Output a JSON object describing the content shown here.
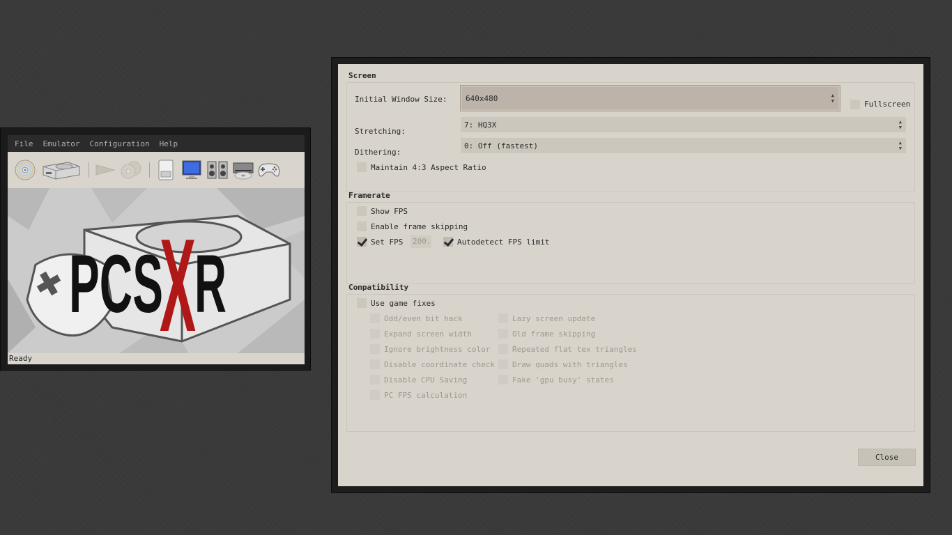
{
  "main_window": {
    "menu": [
      "File",
      "Emulator",
      "Configuration",
      "Help"
    ],
    "toolbar_icons": [
      "cd-icon",
      "console-icon",
      "run-icon",
      "swap-disc-icon",
      "memory-card-icon",
      "monitor-icon",
      "speakers-icon",
      "cdrom-icon",
      "gamepad-icon"
    ],
    "banner_logo": "PCSXR",
    "status": "Ready"
  },
  "config": {
    "screen": {
      "title": "Screen",
      "window_size_label": "Initial Window Size:",
      "window_size_value": "640x480",
      "fullscreen_label": "Fullscreen",
      "fullscreen_checked": false,
      "stretching_label": "Stretching:",
      "stretching_value": "7: HQ3X",
      "dithering_label": "Dithering:",
      "dithering_value": "0: Off (fastest)",
      "aspect_label": "Maintain 4:3 Aspect Ratio",
      "aspect_checked": false
    },
    "framerate": {
      "title": "Framerate",
      "show_fps_label": "Show FPS",
      "show_fps_checked": false,
      "frame_skip_label": "Enable frame skipping",
      "frame_skip_checked": false,
      "set_fps_label": "Set FPS",
      "set_fps_checked": true,
      "fps_value": "200.0",
      "autodetect_label": "Autodetect FPS limit",
      "autodetect_checked": true
    },
    "compatibility": {
      "title": "Compatibility",
      "use_fixes_label": "Use game fixes",
      "use_fixes_checked": false,
      "fixes_left": [
        "Odd/even bit hack",
        "Expand screen width",
        "Ignore brightness color",
        "Disable coordinate check",
        "Disable CPU Saving",
        "PC FPS calculation"
      ],
      "fixes_right": [
        "Lazy screen update",
        "Old frame skipping",
        "Repeated flat tex triangles",
        "Draw quads with triangles",
        "Fake 'gpu busy' states"
      ]
    },
    "close_label": "Close"
  }
}
